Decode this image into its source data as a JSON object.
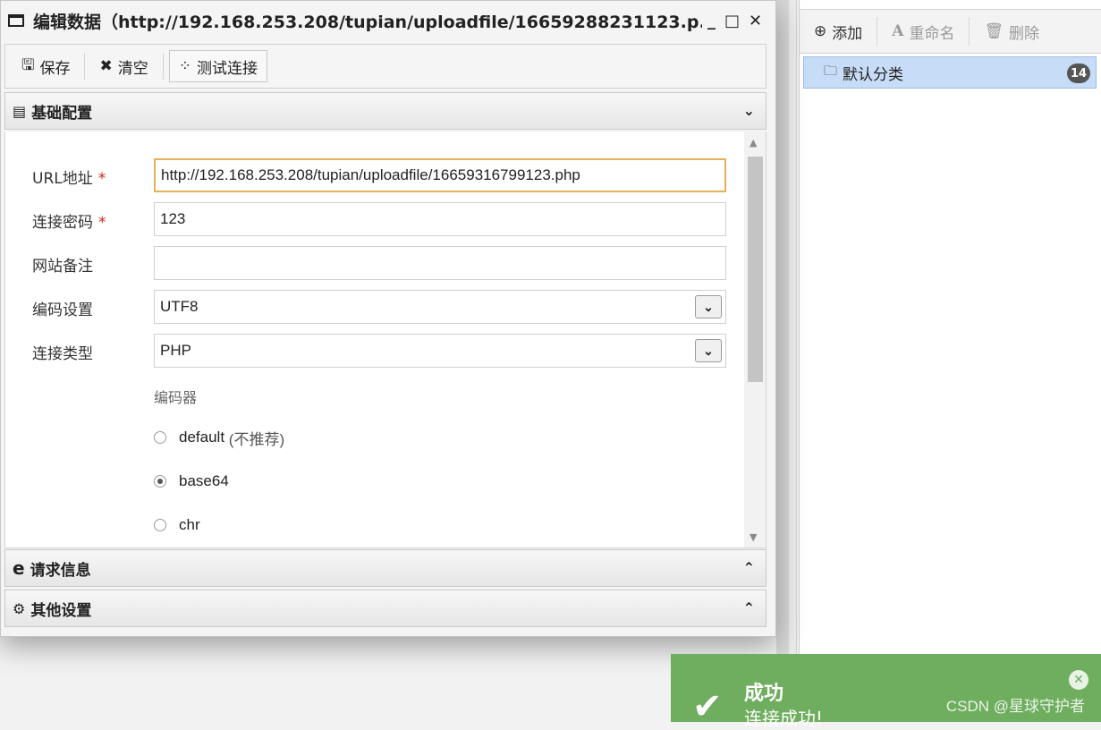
{
  "window": {
    "title": "编辑数据（http://192.168.253.208/tupian/uploadfile/16659288231123.p...",
    "minimize": "_",
    "maximize": "□",
    "close": "✕"
  },
  "toolbar": {
    "save_label": "保存",
    "clear_label": "清空",
    "test_label": "测试连接"
  },
  "sections": {
    "basic": "基础配置",
    "request": "请求信息",
    "other": "其他设置"
  },
  "form": {
    "url_label": "URL地址",
    "url_value": "http://192.168.253.208/tupian/uploadfile/16659316799123.php",
    "password_label": "连接密码",
    "password_value": "123",
    "note_label": "网站备注",
    "note_value": "",
    "encoding_label": "编码设置",
    "encoding_value": "UTF8",
    "type_label": "连接类型",
    "type_value": "PHP",
    "required_mark": "*",
    "encoder_label": "编码器",
    "encoders": [
      {
        "name": "default",
        "note": "(不推荐)",
        "checked": false
      },
      {
        "name": "base64",
        "note": "",
        "checked": true
      },
      {
        "name": "chr",
        "note": "",
        "checked": false
      }
    ]
  },
  "right_panel": {
    "add_label": "添加",
    "rename_label": "重命名",
    "delete_label": "删除",
    "category_name": "默认分类",
    "category_count": "14"
  },
  "toast": {
    "title": "成功",
    "message": "连接成功!",
    "watermark": "CSDN @星球守护者"
  },
  "colors": {
    "toast_bg": "#6fae5f",
    "selected_category": "#c7dcf6",
    "required": "#d9231f",
    "focus_border": "#e2b15a"
  }
}
